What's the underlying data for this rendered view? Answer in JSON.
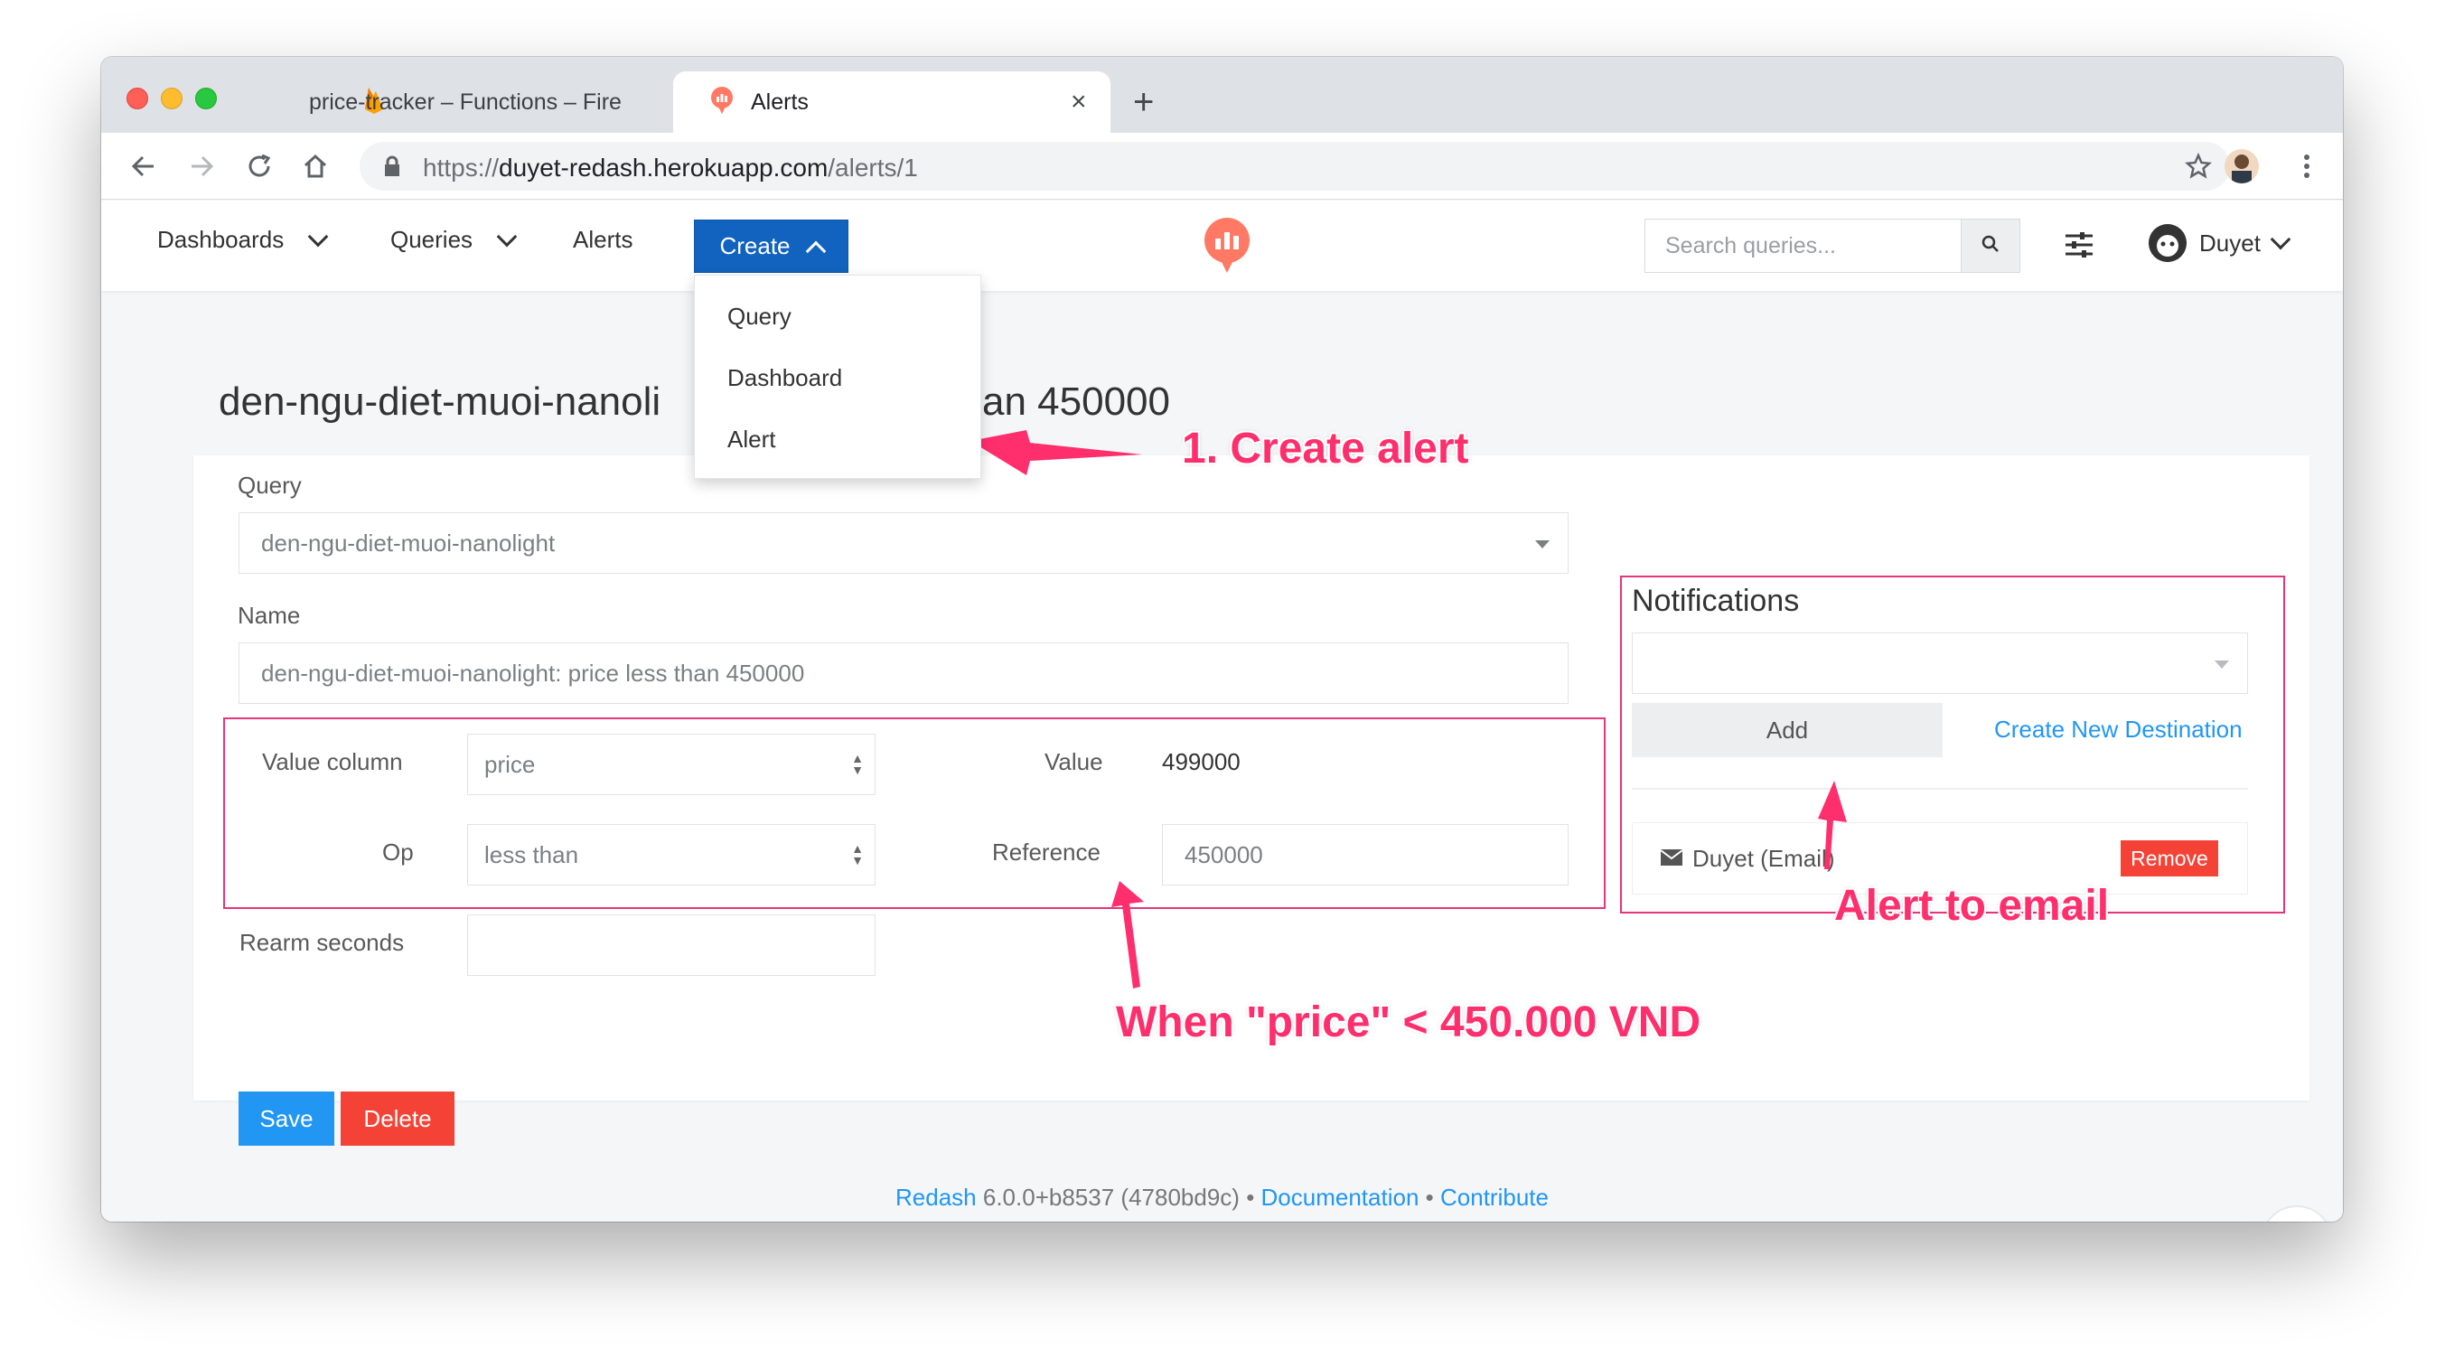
{
  "browser": {
    "tabs": [
      {
        "title": "price-tracker – Functions – Fire",
        "favicon": "firebase-icon",
        "active": false
      },
      {
        "title": "Alerts",
        "favicon": "redash-icon",
        "active": true
      }
    ],
    "url_prefix": "https://",
    "url_host": "duyet-redash.herokuapp.com",
    "url_path": "/alerts/1"
  },
  "navbar": {
    "dashboards": "Dashboards",
    "queries": "Queries",
    "alerts": "Alerts",
    "create": "Create",
    "search_placeholder": "Search queries...",
    "user": "Duyet"
  },
  "create_menu": {
    "items": [
      "Query",
      "Dashboard",
      "Alert"
    ]
  },
  "page": {
    "title_left": "den-ngu-diet-muoi-nanoli",
    "title_right": "an 450000"
  },
  "form": {
    "query_label": "Query",
    "query_value": "den-ngu-diet-muoi-nanolight",
    "name_label": "Name",
    "name_placeholder": "den-ngu-diet-muoi-nanolight: price less than 450000",
    "value_column_label": "Value column",
    "value_column": "price",
    "value_label": "Value",
    "value": "499000",
    "op_label": "Op",
    "op": "less than",
    "reference_label": "Reference",
    "reference": "450000",
    "rearm_label": "Rearm seconds",
    "rearm_value": "",
    "save": "Save",
    "delete": "Delete"
  },
  "notifications": {
    "title": "Notifications",
    "add": "Add",
    "create_destination": "Create New Destination",
    "destinations": [
      {
        "name": "Duyet (Email)",
        "remove": "Remove"
      }
    ]
  },
  "footer": {
    "product": "Redash",
    "version": "6.0.0+b8537 (4780bd9c)",
    "sep": "•",
    "documentation": "Documentation",
    "contribute": "Contribute"
  },
  "annotations": {
    "create_alert": "1. Create alert",
    "when_price": "When \"price\" < 450.000 VND",
    "alert_email": "Alert to email"
  },
  "colors": {
    "annotation": "#ff2e6c",
    "primary": "#1163bf",
    "link": "#2196f3",
    "danger": "#f44336"
  }
}
